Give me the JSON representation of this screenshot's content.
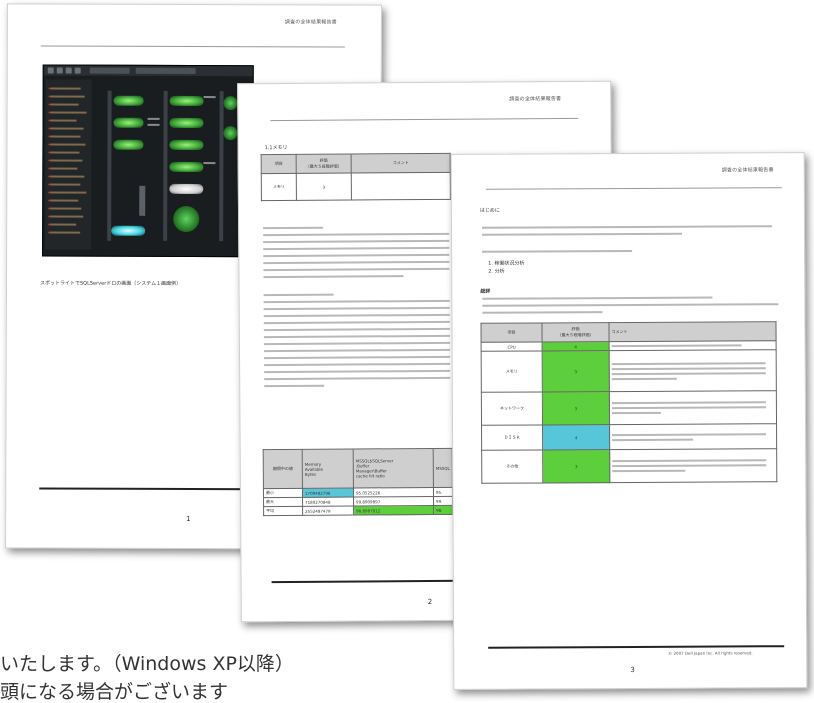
{
  "page1": {
    "header_title": "調査の全体結果報告書",
    "caption": "スポットライトでSQLServerドロの画面（システム１画面例）",
    "page_number": "1"
  },
  "page2": {
    "header_title": "調査の全体結果報告書",
    "section_title": "1.1メモリ",
    "table_headers": [
      "項目",
      "評価\n（最大５段階評価）",
      "コメント"
    ],
    "table_row": [
      "メモリ",
      "3"
    ],
    "bottom_table": {
      "headers": [
        "期間中の値",
        "Memory\nAvailable\nBytes",
        "MSSQL$SQLServer\n:Buffer\nManager\\Buffer\ncache hit ratio",
        "MSSQL"
      ],
      "rows": [
        [
          "最小",
          "1709482796",
          "95.0525226",
          "95."
        ],
        [
          "最大",
          "7180270848",
          "99.8909897",
          "99."
        ],
        [
          "平均",
          "2552487479",
          "98.8987812",
          "98."
        ]
      ]
    },
    "page_number": "2"
  },
  "page3": {
    "header_title": "調査の全体結果報告書",
    "section_title": "はじめに",
    "summary_title": "総評",
    "table_headers": [
      "項目",
      "評価\n（最大５段階評価）",
      "コメント"
    ],
    "table_rows": [
      {
        "item": "CPU",
        "score": "4"
      },
      {
        "item": "メモリ",
        "score": "3"
      },
      {
        "item": "ネットワーク",
        "score": "3"
      },
      {
        "item": "ＤＩＳＫ",
        "score": "4"
      },
      {
        "item": "その他",
        "score": "3"
      }
    ],
    "list_items": [
      "1. 稼働状況分析",
      "2. 分析"
    ],
    "page_number": "3",
    "copyright": "© 2007 Dell Japan Inc. All rights reserved."
  },
  "bottom_text": {
    "line1": "いたします。（Windows XP以降）",
    "line2": "頭になる場合がございます"
  },
  "colors": {
    "green_cell": "#5ecf3c",
    "blue_cell": "#57c6d9",
    "screenshot_bg": "#1a1d1f"
  }
}
